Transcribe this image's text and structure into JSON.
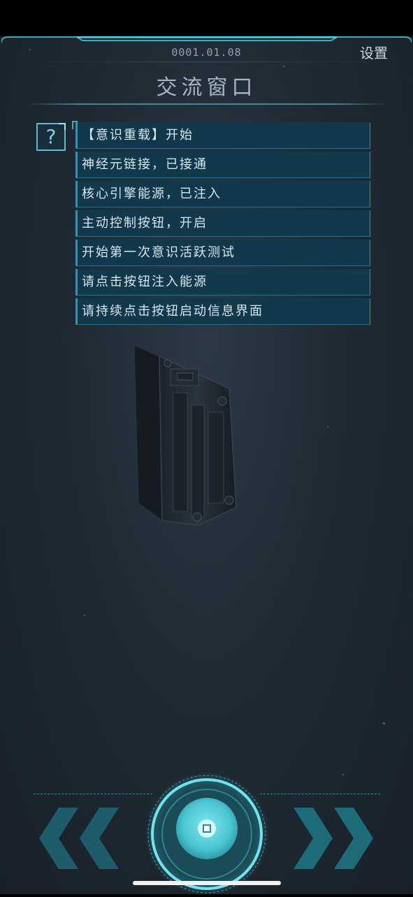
{
  "header": {
    "date": "0001.01.08",
    "settings_label": "设置",
    "title": "交流窗口"
  },
  "help": {
    "label": "?"
  },
  "messages": [
    "【意识重载】开始",
    "神经元链接，已接通",
    "核心引擎能源，已注入",
    "主动控制按钮，开启",
    "开始第一次意识活跃测试",
    "请点击按钮注入能源",
    "请持续点击按钮启动信息界面"
  ],
  "controls": {
    "left_icon": "double-chevron-left-icon",
    "right_icon": "double-chevron-right-icon",
    "center_icon": "energy-core-button-icon"
  },
  "colors": {
    "accent": "#4fd8e4",
    "panel": "#12384c",
    "background": "#1f2a34"
  }
}
